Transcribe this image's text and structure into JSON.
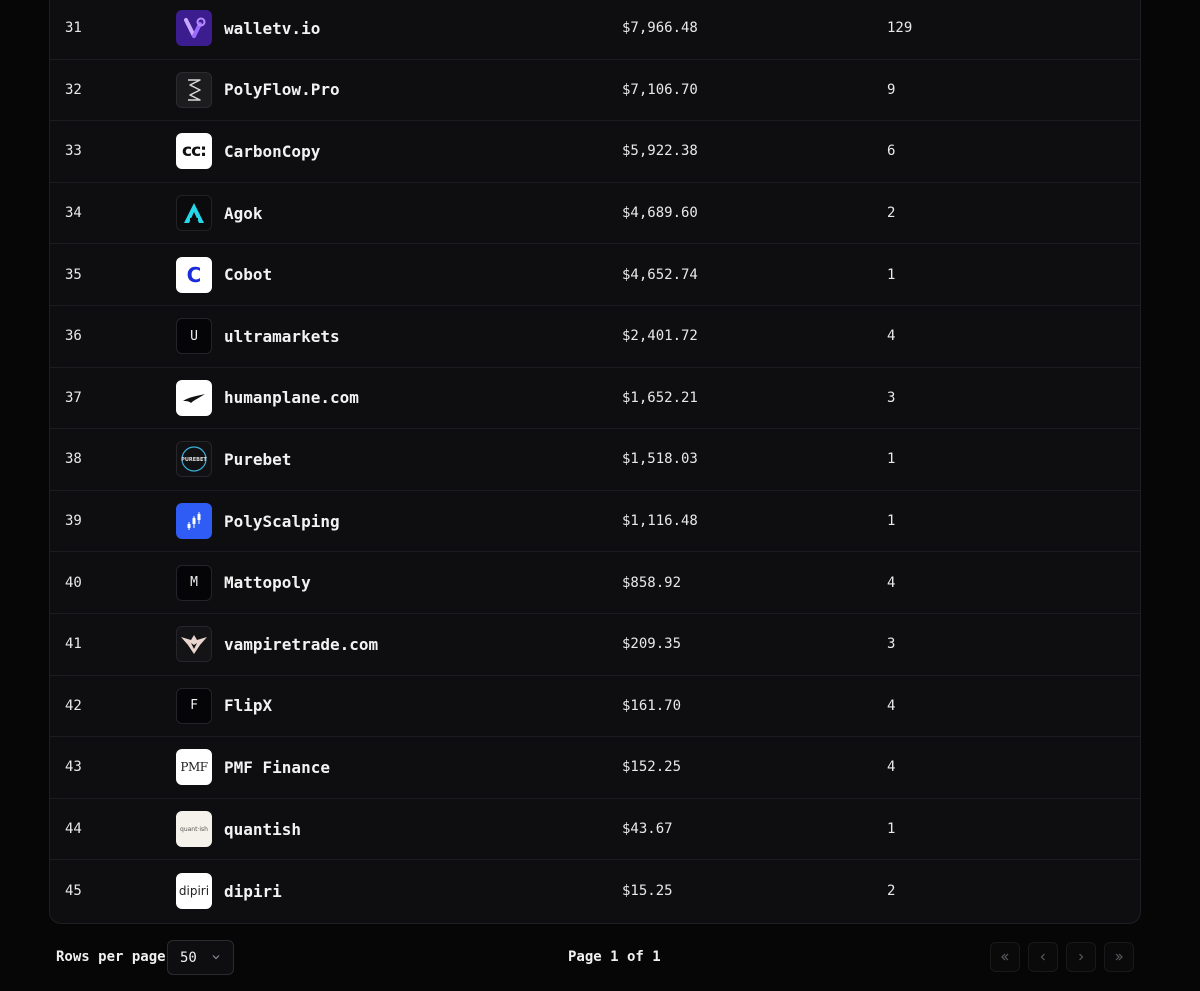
{
  "rows": [
    {
      "rank": "31",
      "name": "walletv.io",
      "volume": "$7,966.48",
      "count": "129",
      "logo": "walletv-icon"
    },
    {
      "rank": "32",
      "name": "PolyFlow.Pro",
      "volume": "$7,106.70",
      "count": "9",
      "logo": "polyflow-icon"
    },
    {
      "rank": "33",
      "name": "CarbonCopy",
      "volume": "$5,922.38",
      "count": "6",
      "logo": "carboncopy-icon",
      "logo_text": "cc:"
    },
    {
      "rank": "34",
      "name": "Agok",
      "volume": "$4,689.60",
      "count": "2",
      "logo": "agok-icon"
    },
    {
      "rank": "35",
      "name": "Cobot",
      "volume": "$4,652.74",
      "count": "1",
      "logo": "cobot-icon",
      "logo_text": "C"
    },
    {
      "rank": "36",
      "name": "ultramarkets",
      "volume": "$2,401.72",
      "count": "4",
      "logo": "letter-u-icon",
      "logo_text": "U"
    },
    {
      "rank": "37",
      "name": "humanplane.com",
      "volume": "$1,652.21",
      "count": "3",
      "logo": "humanplane-icon"
    },
    {
      "rank": "38",
      "name": "Purebet",
      "volume": "$1,518.03",
      "count": "1",
      "logo": "purebet-icon",
      "logo_text": "PUREBET"
    },
    {
      "rank": "39",
      "name": "PolyScalping",
      "volume": "$1,116.48",
      "count": "1",
      "logo": "polyscalping-icon"
    },
    {
      "rank": "40",
      "name": "Mattopoly",
      "volume": "$858.92",
      "count": "4",
      "logo": "letter-m-icon",
      "logo_text": "M"
    },
    {
      "rank": "41",
      "name": "vampiretrade.com",
      "volume": "$209.35",
      "count": "3",
      "logo": "vampiretrade-icon"
    },
    {
      "rank": "42",
      "name": "FlipX",
      "volume": "$161.70",
      "count": "4",
      "logo": "letter-f-icon",
      "logo_text": "F"
    },
    {
      "rank": "43",
      "name": "PMF Finance",
      "volume": "$152.25",
      "count": "4",
      "logo": "pmf-icon",
      "logo_text": "PMF"
    },
    {
      "rank": "44",
      "name": "quantish",
      "volume": "$43.67",
      "count": "1",
      "logo": "quantish-icon",
      "logo_text": "quant·ish"
    },
    {
      "rank": "45",
      "name": "dipiri",
      "volume": "$15.25",
      "count": "2",
      "logo": "dipiri-icon",
      "logo_text": "dipiri"
    }
  ],
  "footer": {
    "rows_per_page_label": "Rows per page",
    "rows_per_page_value": "50",
    "page_indicator": "Page 1 of 1"
  },
  "colors": {
    "background": "#060607",
    "card": "#0e0e10",
    "walletv": "#3b1d8f",
    "agok": "#25d7e8",
    "cobot": "#1a2bd9",
    "polyscalping": "#2f5cf5"
  }
}
